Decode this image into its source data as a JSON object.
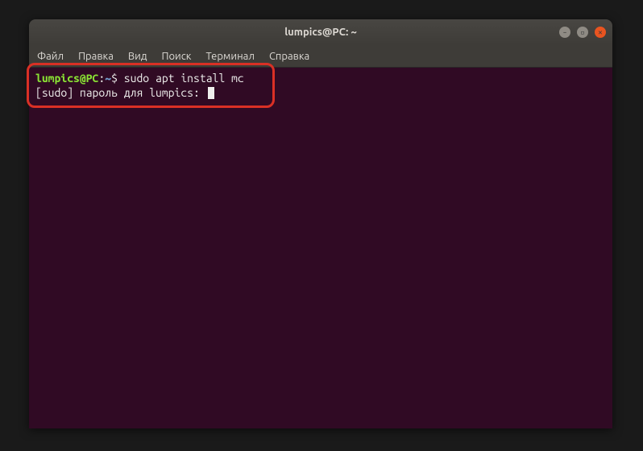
{
  "title": "lumpics@PC: ~",
  "menu": {
    "file": "Файл",
    "edit": "Правка",
    "view": "Вид",
    "search": "Поиск",
    "terminal": "Терминал",
    "help": "Справка"
  },
  "prompt": {
    "user_host": "lumpics@PC",
    "separator": ":",
    "path": "~",
    "dollar": "$ "
  },
  "command": "sudo apt install mc",
  "sudo_line": "[sudo] пароль для lumpics: ",
  "ctrl_min": "–",
  "ctrl_max": "▫",
  "ctrl_close": "✕"
}
